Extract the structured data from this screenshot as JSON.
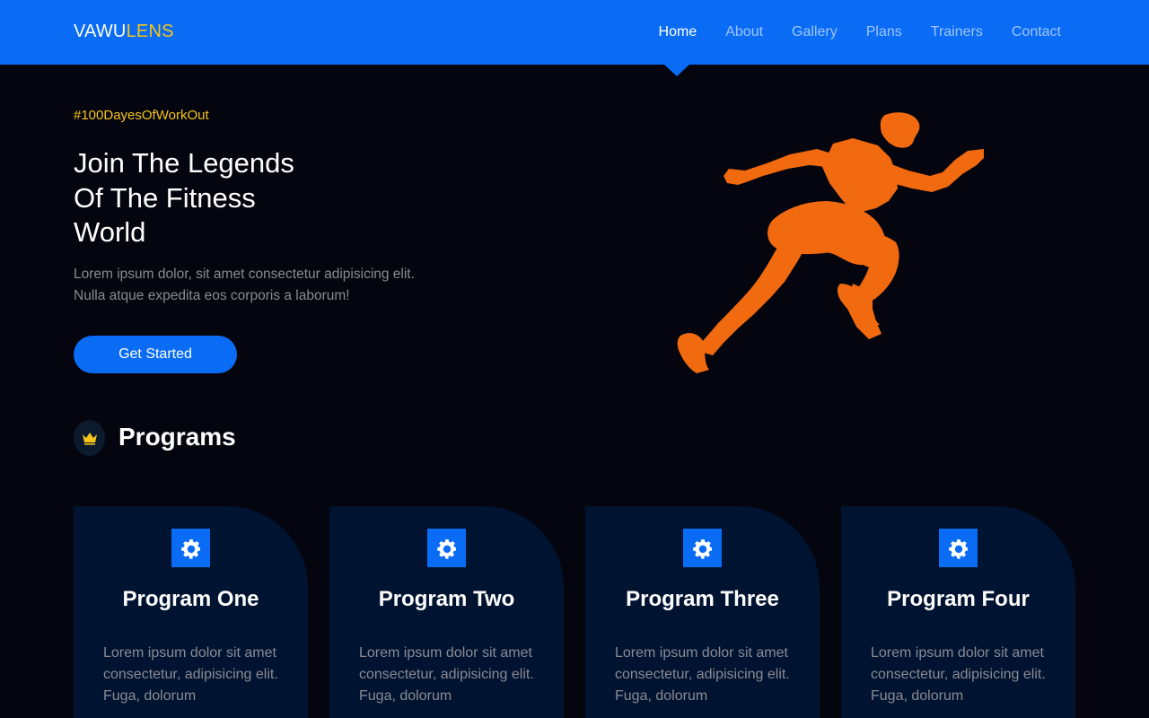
{
  "navbar": {
    "brand_part1": "VAWU",
    "brand_part2": "LENS",
    "links": [
      {
        "label": "Home",
        "active": true
      },
      {
        "label": "About"
      },
      {
        "label": "Gallery"
      },
      {
        "label": "Plans"
      },
      {
        "label": "Trainers"
      },
      {
        "label": "Contact"
      }
    ]
  },
  "hero": {
    "tagline": "#100DayesOfWorkOut",
    "title_lines": [
      "Join The Legends",
      "Of The Fitness",
      "World"
    ],
    "text_lines": [
      "Lorem ipsum dolor, sit amet consectetur adipisicing elit.",
      "Nulla atque expedita eos corporis a laborum!"
    ],
    "cta_label": "Get Started",
    "image": "orange-runner-silhouette"
  },
  "programs": {
    "title": "Programs",
    "icon": "crown-icon",
    "cards": [
      {
        "title": "Program One",
        "text": "Lorem ipsum dolor sit amet consectetur, adipisicing elit. Fuga, dolorum",
        "icon": "gear-icon"
      },
      {
        "title": "Program Two",
        "text": "Lorem ipsum dolor sit amet consectetur, adipisicing elit. Fuga, dolorum",
        "icon": "gear-icon"
      },
      {
        "title": "Program Three",
        "text": "Lorem ipsum dolor sit amet consectetur, adipisicing elit. Fuga, dolorum",
        "icon": "gear-icon"
      },
      {
        "title": "Program Four",
        "text": "Lorem ipsum dolor sit amet consectetur, adipisicing elit. Fuga, dolorum",
        "icon": "gear-icon"
      }
    ]
  },
  "colors": {
    "primary": "#0a6cf5",
    "accent": "#f5c518",
    "background": "#05050f",
    "card": "#001431",
    "runner": "#f26a0f"
  }
}
